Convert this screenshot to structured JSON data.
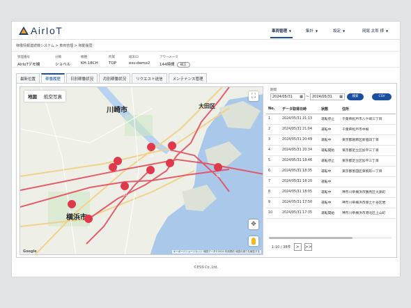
{
  "app": {
    "logo": "AirIoT"
  },
  "nav": [
    {
      "label": "車両管理",
      "active": true
    },
    {
      "label": "集計"
    },
    {
      "label": "設定"
    },
    {
      "label": "岡尾 太郎 様"
    }
  ],
  "breadcrumb": "稼働情報連続機システム > 車両管理 > 稼動履歴",
  "info": {
    "fields": [
      {
        "label": "管理番号",
        "value": "AirIoTデモ機"
      },
      {
        "label": "分類",
        "value": "ショベル"
      },
      {
        "label": "機種",
        "value": "KH-18CH"
      },
      {
        "label": "所属",
        "value": "TOP"
      },
      {
        "label": "端末ID",
        "value": "ess-demo2"
      },
      {
        "label": "アワーメータ",
        "value": "144時間"
      }
    ],
    "hour_button": "補正"
  },
  "tabs": [
    "最新位置",
    "稼働履歴",
    "日別稼働状況",
    "月別稼働状況",
    "リクエスト送信",
    "メンテナンス管理"
  ],
  "map": {
    "tabs": [
      "地図",
      "航空写真"
    ],
    "labels": [
      "川崎市",
      "大田区",
      "横浜市"
    ],
    "markers": [
      "23",
      "31",
      "29",
      "8",
      "15",
      "30",
      "31",
      "14",
      "9",
      "5"
    ],
    "footer": "キーボードショートカット 地図データ©2024 利用規約 地図の誤りを報告する",
    "google": "Google"
  },
  "filter": {
    "period_label": "期間",
    "start": "2024/05/31",
    "end": "2024/05/31",
    "search": "検索",
    "csv": "CSV"
  },
  "table": {
    "headers": [
      "No.",
      "データ取得日時",
      "状態",
      "住所"
    ],
    "rows": [
      [
        "1",
        "2024/05/31 21:13",
        "運転停止",
        "千葉県松戸市八ケ崎三丁目"
      ],
      [
        "2",
        "2024/05/31 21:04",
        "運転中",
        "千葉県松戸市中根"
      ],
      [
        "3",
        "2024/05/31 20:49",
        "運転中",
        "東京都葛飾区新宿四丁目"
      ],
      [
        "4",
        "2024/05/31 20:34",
        "運転開始",
        "東京都足立区加平三丁目"
      ],
      [
        "5",
        "2024/05/31 18:46",
        "運転停止",
        "東京都足立区加平三丁目"
      ],
      [
        "6",
        "2024/05/31 18:35",
        "運転中",
        "東京都墨田区東駒形一丁目"
      ],
      [
        "7",
        "2024/05/31 18:20",
        "運転中",
        ""
      ],
      [
        "8",
        "2024/05/31 18:05",
        "運転中",
        "神奈川県横浜市鶴見区大黒町"
      ],
      [
        "9",
        "2024/05/31 17:50",
        "運転中",
        "神奈川県横浜市保土ケ谷区岩"
      ],
      [
        "10",
        "2024/05/31 17:35",
        "運転開始",
        "神奈川県横浜市港北区上山町"
      ]
    ]
  },
  "pager": {
    "text": "1-10 / 38件",
    "next": ">",
    "last": ">>"
  },
  "footer": "©ESS Co.,Ltd.",
  "colors": {
    "accent": "#1a4ea0",
    "marker": "#e0394c",
    "route": "#e64c5c",
    "water": "#a9c8ea"
  }
}
